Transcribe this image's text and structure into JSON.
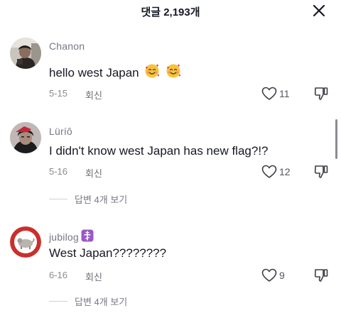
{
  "header": {
    "title": "댓글 2,193개",
    "close_icon": "close-icon"
  },
  "comments": [
    {
      "username": "Chanon",
      "text": "hello west Japan",
      "emojis": [
        "smiling-face-with-hearts",
        "smiling-face-with-hearts"
      ],
      "date": "5-15",
      "reply_label": "회신",
      "like_count": "11"
    },
    {
      "username": "Lüríô",
      "text": "I didn't know west Japan has new flag?!?",
      "date": "5-16",
      "reply_label": "회신",
      "like_count": "12",
      "view_replies": "답변 4개 보기"
    },
    {
      "username": "jubilog",
      "badge": "orthodox-cross-emoji",
      "text": "West Japan????????",
      "date": "6-16",
      "reply_label": "회신",
      "like_count": "9",
      "view_replies": "답변 4개 보기"
    }
  ],
  "colors": {
    "text_primary": "#161823",
    "text_secondary": "#767882",
    "badge_purple": "#9b59c6"
  }
}
